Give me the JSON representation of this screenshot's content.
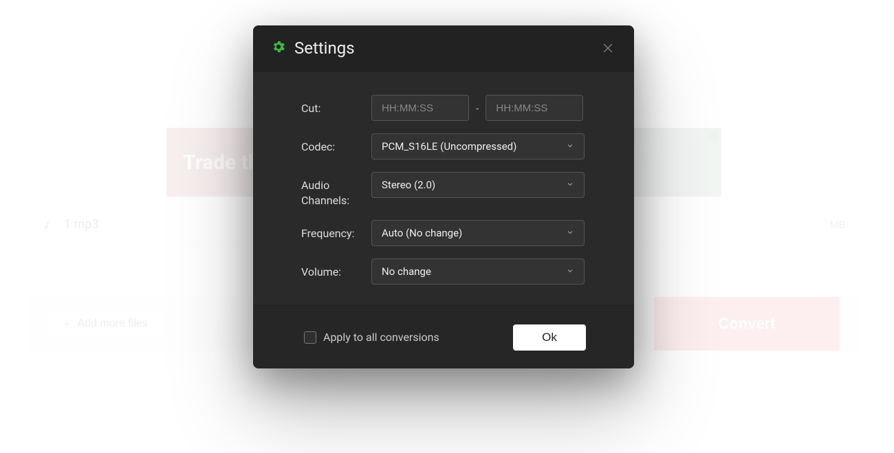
{
  "background": {
    "ad_text": "Trade th",
    "file_name": "1 mp3",
    "file_size_suffix": "MB",
    "add_more_label": "Add more files",
    "convert_label": "Convert"
  },
  "modal": {
    "title": "Settings",
    "labels": {
      "cut": "Cut:",
      "codec": "Codec:",
      "audio_channels": "Audio Channels:",
      "frequency": "Frequency:",
      "volume": "Volume:"
    },
    "placeholders": {
      "cut_time": "HH:MM:SS"
    },
    "dash": "-",
    "values": {
      "codec": "PCM_S16LE (Uncompressed)",
      "audio_channels": "Stereo (2.0)",
      "frequency": "Auto (No change)",
      "volume": "No change"
    },
    "apply_all_label": "Apply to all conversions",
    "ok_label": "Ok"
  },
  "icons": {
    "gear": "gear-icon",
    "close": "close-icon",
    "chevron_down": "chevron-down-icon",
    "plus": "plus-icon",
    "music": "music-note-icon"
  }
}
